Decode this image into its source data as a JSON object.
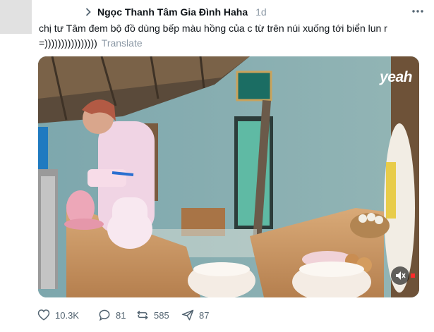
{
  "post": {
    "author": "Ngọc Thanh Tâm Gia Đình Haha",
    "time": "1d",
    "text": "chị tư Tâm đem bộ đồ dùng bếp màu hồng của c từ trên núi xuống tới biển lun r =))))))))))))))))",
    "translate_label": "Translate"
  },
  "media": {
    "logo": "yeah",
    "mute_icon": "volume-off-icon"
  },
  "actions": {
    "likes": "10.3K",
    "replies": "81",
    "reposts": "585",
    "views": "87"
  },
  "colors": {
    "text": "#0f1419",
    "muted": "#8b98a5",
    "action": "#536471"
  }
}
